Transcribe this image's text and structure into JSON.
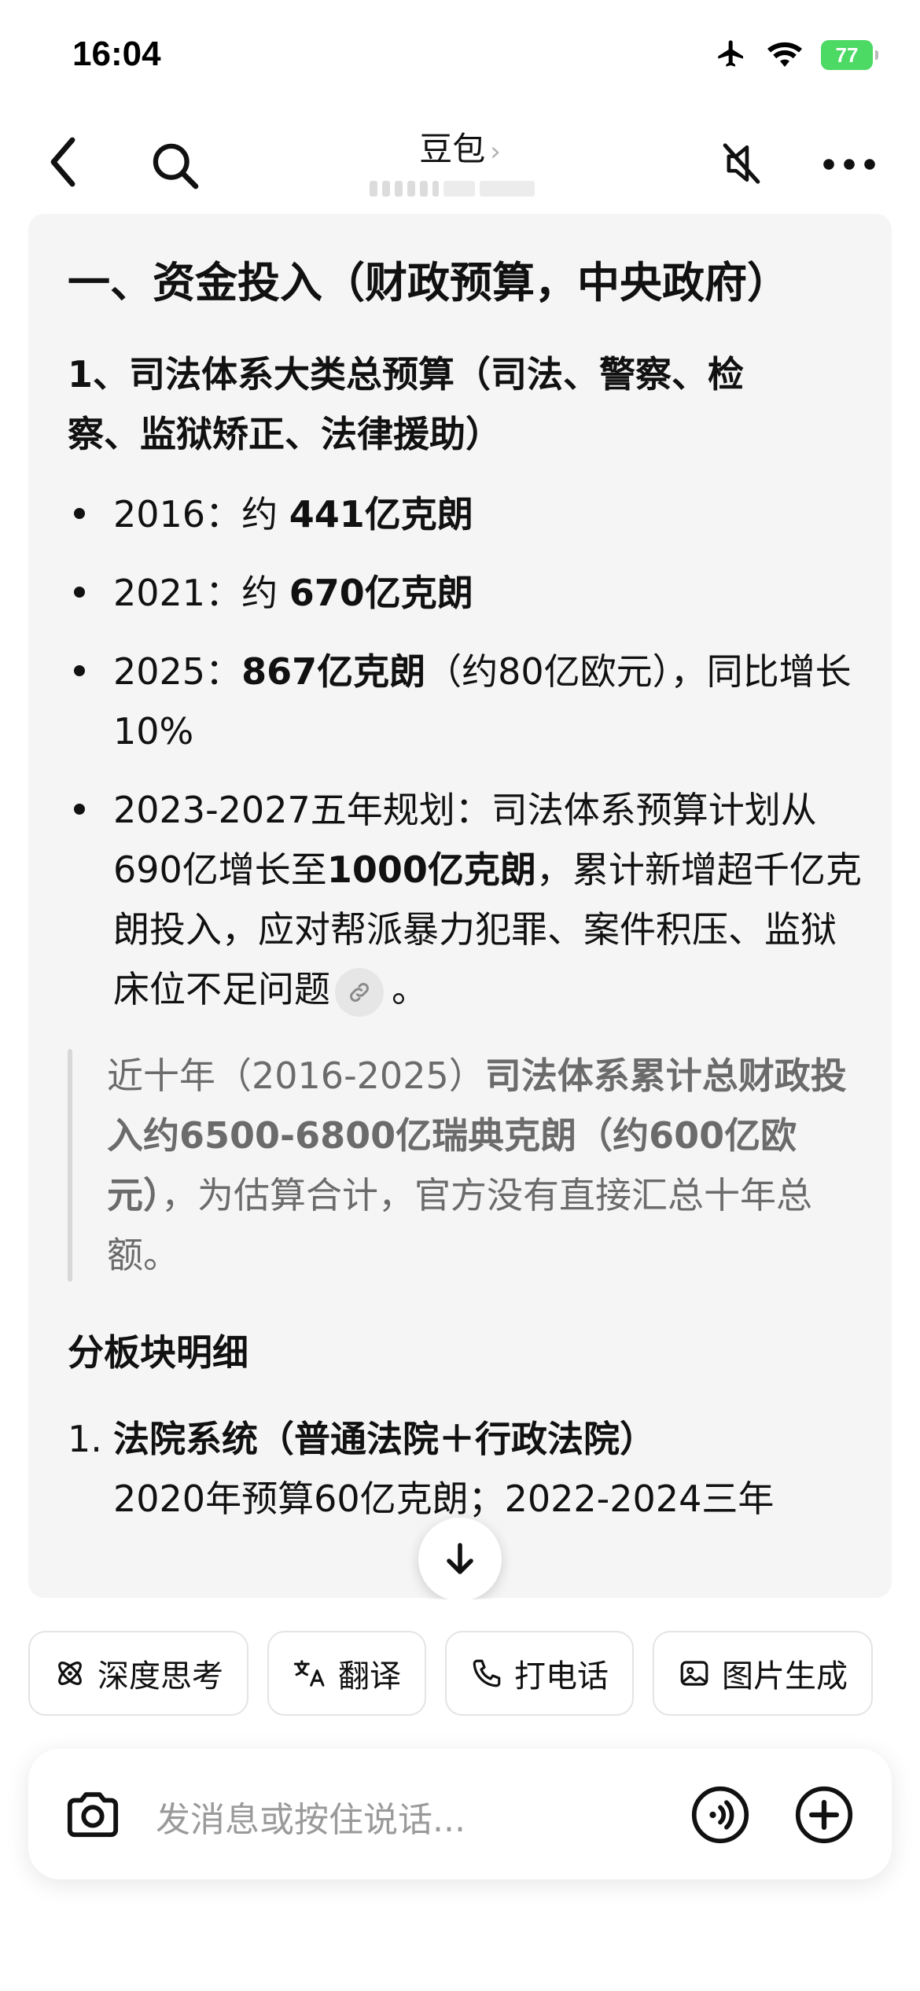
{
  "status_bar": {
    "time": "16:04",
    "battery": "77"
  },
  "nav": {
    "title": "豆包",
    "title_chevron": "›"
  },
  "content": {
    "heading1": "一、资金投入（财政预算，中央政府）",
    "heading2_line1": "1、司法体系大类总预算（司法、警察、检",
    "heading2_line2": "察、监狱矫正、法律援助）",
    "bullets": [
      {
        "prefix": "2016：约 ",
        "bold": "441亿克朗",
        "suffix": ""
      },
      {
        "prefix": "2021：约 ",
        "bold": "670亿克朗",
        "suffix": ""
      },
      {
        "prefix": "2025：",
        "bold": "867亿克朗",
        "suffix": "（约80亿欧元），同比增长10%"
      },
      {
        "prefix": "2023-2027五年规划：司法体系预算计划从690亿增长至",
        "bold": "1000亿克朗",
        "suffix": "，累计新增超千亿克朗投入，应对帮派暴力犯罪、案件积压、监狱床位不足问题"
      }
    ],
    "bullet_end": "。",
    "quote": {
      "prefix": "近十年（2016-2025）",
      "bold1": "司法体系累计总财政投入约6500-6800亿瑞典克朗（约600亿欧元）",
      "suffix": "，为估算合计，官方没有直接汇总十年总额。"
    },
    "heading3": "分板块明细",
    "numbered": [
      {
        "num": "1.",
        "title": "法院系统（普通法院＋行政法院）",
        "line2": "2020年预算60亿克朗；2022-2024三年"
      }
    ]
  },
  "chips": [
    {
      "icon": "atom-icon",
      "label": "深度思考"
    },
    {
      "icon": "translate-icon",
      "label": "翻译"
    },
    {
      "icon": "phone-icon",
      "label": "打电话"
    },
    {
      "icon": "image-icon",
      "label": "图片生成"
    }
  ],
  "input": {
    "placeholder": "发消息或按住说话..."
  }
}
